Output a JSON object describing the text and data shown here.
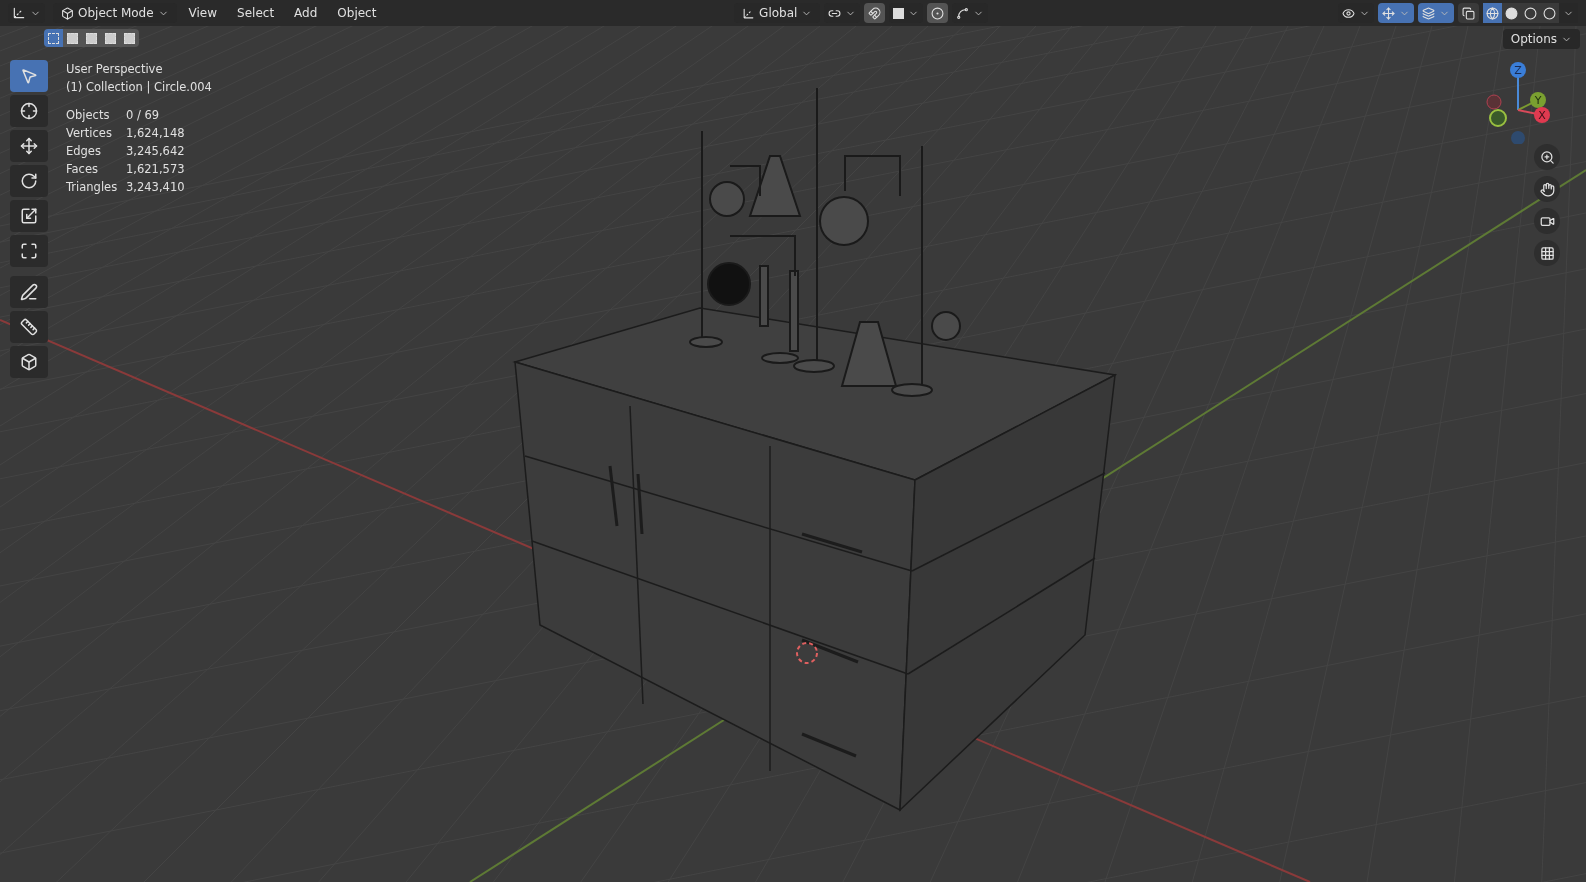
{
  "header": {
    "mode": "Object Mode",
    "menus": [
      "View",
      "Select",
      "Add",
      "Object"
    ],
    "orientation": "Global",
    "snap": {
      "selected": false
    },
    "proportional": {
      "selected": false
    },
    "gizmos": {
      "selected": true
    },
    "overlays": {
      "selected": true
    },
    "xray": {
      "selected": false
    },
    "shading": [
      {
        "selected": true
      },
      {
        "selected": false
      },
      {
        "selected": false
      },
      {
        "selected": false
      }
    ]
  },
  "tool_header": {
    "select_modes": [
      {
        "selected": true
      },
      {
        "selected": false
      },
      {
        "selected": false
      },
      {
        "selected": false
      },
      {
        "selected": false
      }
    ],
    "options": "Options"
  },
  "toolbar": [
    {
      "selected": true
    },
    {
      "selected": false
    },
    {
      "selected": false
    },
    {
      "selected": false
    },
    {
      "selected": false
    },
    {
      "selected": false
    },
    {
      "selected": false
    },
    {
      "selected": false
    },
    {
      "selected": false
    }
  ],
  "overlay": {
    "view": "User Perspective",
    "context": "(1) Collection | Circle.004",
    "stats": [
      {
        "label": "Objects",
        "value": "0 / 69"
      },
      {
        "label": "Vertices",
        "value": "1,624,148"
      },
      {
        "label": "Edges",
        "value": "3,245,642"
      },
      {
        "label": "Faces",
        "value": "1,621,573"
      },
      {
        "label": "Triangles",
        "value": "3,243,410"
      }
    ]
  },
  "gizmo": {
    "z": "Z",
    "y": "Y",
    "x": "X"
  }
}
